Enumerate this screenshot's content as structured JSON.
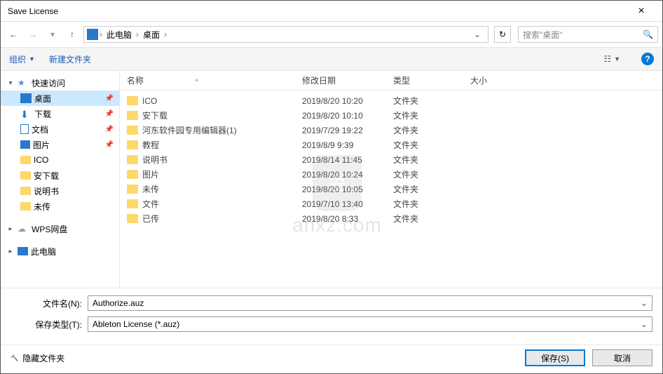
{
  "title": "Save License",
  "path": {
    "root": "此电脑",
    "current": "桌面"
  },
  "search_placeholder": "搜索\"桌面\"",
  "toolbar": {
    "organize": "组织",
    "newfolder": "新建文件夹"
  },
  "sidebar": {
    "quick": "快速访问",
    "items": [
      {
        "label": "桌面",
        "type": "desktop",
        "pinned": true,
        "selected": true
      },
      {
        "label": "下载",
        "type": "download",
        "pinned": true
      },
      {
        "label": "文档",
        "type": "doc",
        "pinned": true
      },
      {
        "label": "图片",
        "type": "pic",
        "pinned": true
      },
      {
        "label": "ICO",
        "type": "folder"
      },
      {
        "label": "安下载",
        "type": "folder"
      },
      {
        "label": "说明书",
        "type": "folder"
      },
      {
        "label": "未传",
        "type": "folder"
      }
    ],
    "wps": "WPS网盘",
    "pc": "此电脑"
  },
  "columns": {
    "name": "名称",
    "date": "修改日期",
    "type": "类型",
    "size": "大小"
  },
  "rows": [
    {
      "name": "ICO",
      "date": "2019/8/20 10:20",
      "type": "文件夹"
    },
    {
      "name": "安下载",
      "date": "2019/8/20 10:10",
      "type": "文件夹"
    },
    {
      "name": "河东软件园专用编辑器(1)",
      "date": "2019/7/29 19:22",
      "type": "文件夹"
    },
    {
      "name": "教程",
      "date": "2019/8/9 9:39",
      "type": "文件夹"
    },
    {
      "name": "说明书",
      "date": "2019/8/14 11:45",
      "type": "文件夹"
    },
    {
      "name": "图片",
      "date": "2019/8/20 10:24",
      "type": "文件夹"
    },
    {
      "name": "未传",
      "date": "2019/8/20 10:05",
      "type": "文件夹"
    },
    {
      "name": "文件",
      "date": "2019/7/10 13:40",
      "type": "文件夹"
    },
    {
      "name": "已传",
      "date": "2019/8/20 8:33",
      "type": "文件夹"
    }
  ],
  "filename_label": "文件名(N):",
  "filename_value": "Authorize.auz",
  "filetype_label": "保存类型(T):",
  "filetype_value": "Ableton License (*.auz)",
  "hide_folders": "隐藏文件夹",
  "save_btn": "保存(S)",
  "cancel_btn": "取消",
  "watermark": "anxz.com"
}
